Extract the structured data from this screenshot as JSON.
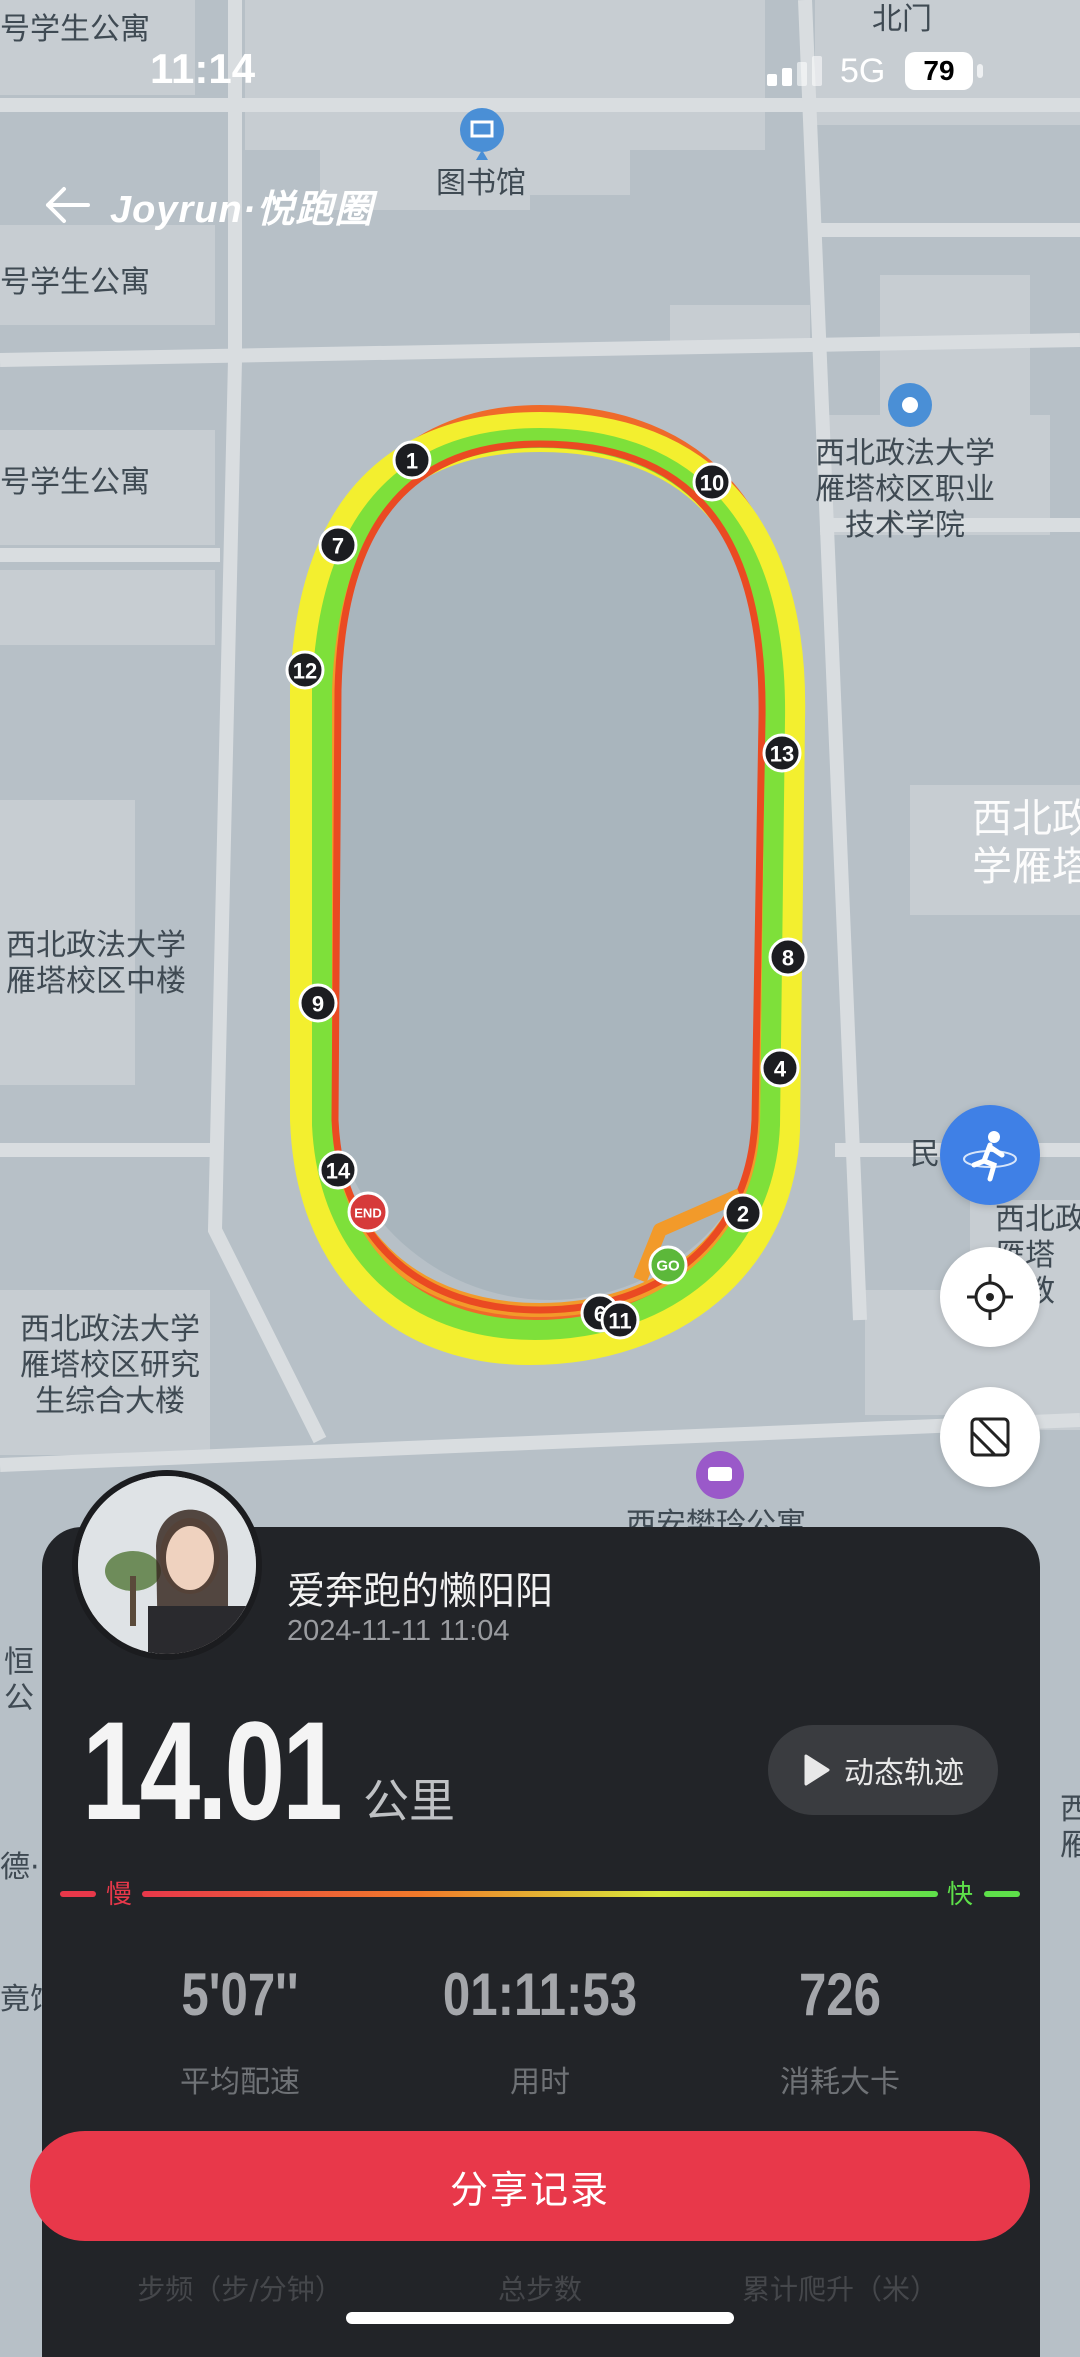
{
  "status_bar": {
    "time": "11:14",
    "network": "5G",
    "battery": "79"
  },
  "header": {
    "brand": "Joyrun·悦跑圈"
  },
  "map_labels": {
    "top_dorm": "号学生公寓",
    "north_gate": "北门",
    "library": "图书馆",
    "dorm_2": "号学生公寓",
    "dorm_3": "号学生公寓",
    "vocational": "西北政法大学\n雁塔校区职业\n技术学院",
    "campus_big": "西北政\n学雁塔",
    "middle_building": "西北政法大学\n雁塔校区中楼",
    "min": "民",
    "right_cut": "西北政\n雁塔\n号教",
    "graduate": "西北政法大学\n雁塔校区研究\n生综合大楼",
    "apartment": "西安樊玲公寓",
    "heng": "恒\n公",
    "de": "德·",
    "guan": "竟馆",
    "xi": "西\n雁"
  },
  "route_markers": {
    "k1": "1",
    "k2": "2",
    "k4": "4",
    "k6": "6",
    "k7": "7",
    "k8": "8",
    "k9": "9",
    "k10": "10",
    "k11": "11",
    "k12": "12",
    "k13": "13",
    "k14": "14",
    "start": "GO",
    "end": "END"
  },
  "profile": {
    "name": "爱奔跑的懒阳阳",
    "datetime": "2024-11-11 11:04"
  },
  "summary": {
    "distance": "14.01",
    "unit": "公里",
    "replay_label": "动态轨迹"
  },
  "pace_legend": {
    "slow": "慢",
    "fast": "快",
    "slow_color": "#e8384a",
    "fast_color": "#5ee04a"
  },
  "stats": [
    {
      "value": "5'07''",
      "label": "平均配速"
    },
    {
      "value": "01:11:53",
      "label": "用时"
    },
    {
      "value": "726",
      "label": "消耗大卡"
    }
  ],
  "share_label": "分享记录",
  "hidden_stats": {
    "cadence": "步频（步/分钟）",
    "steps": "总步数",
    "elevation": "累计爬升（米）"
  }
}
